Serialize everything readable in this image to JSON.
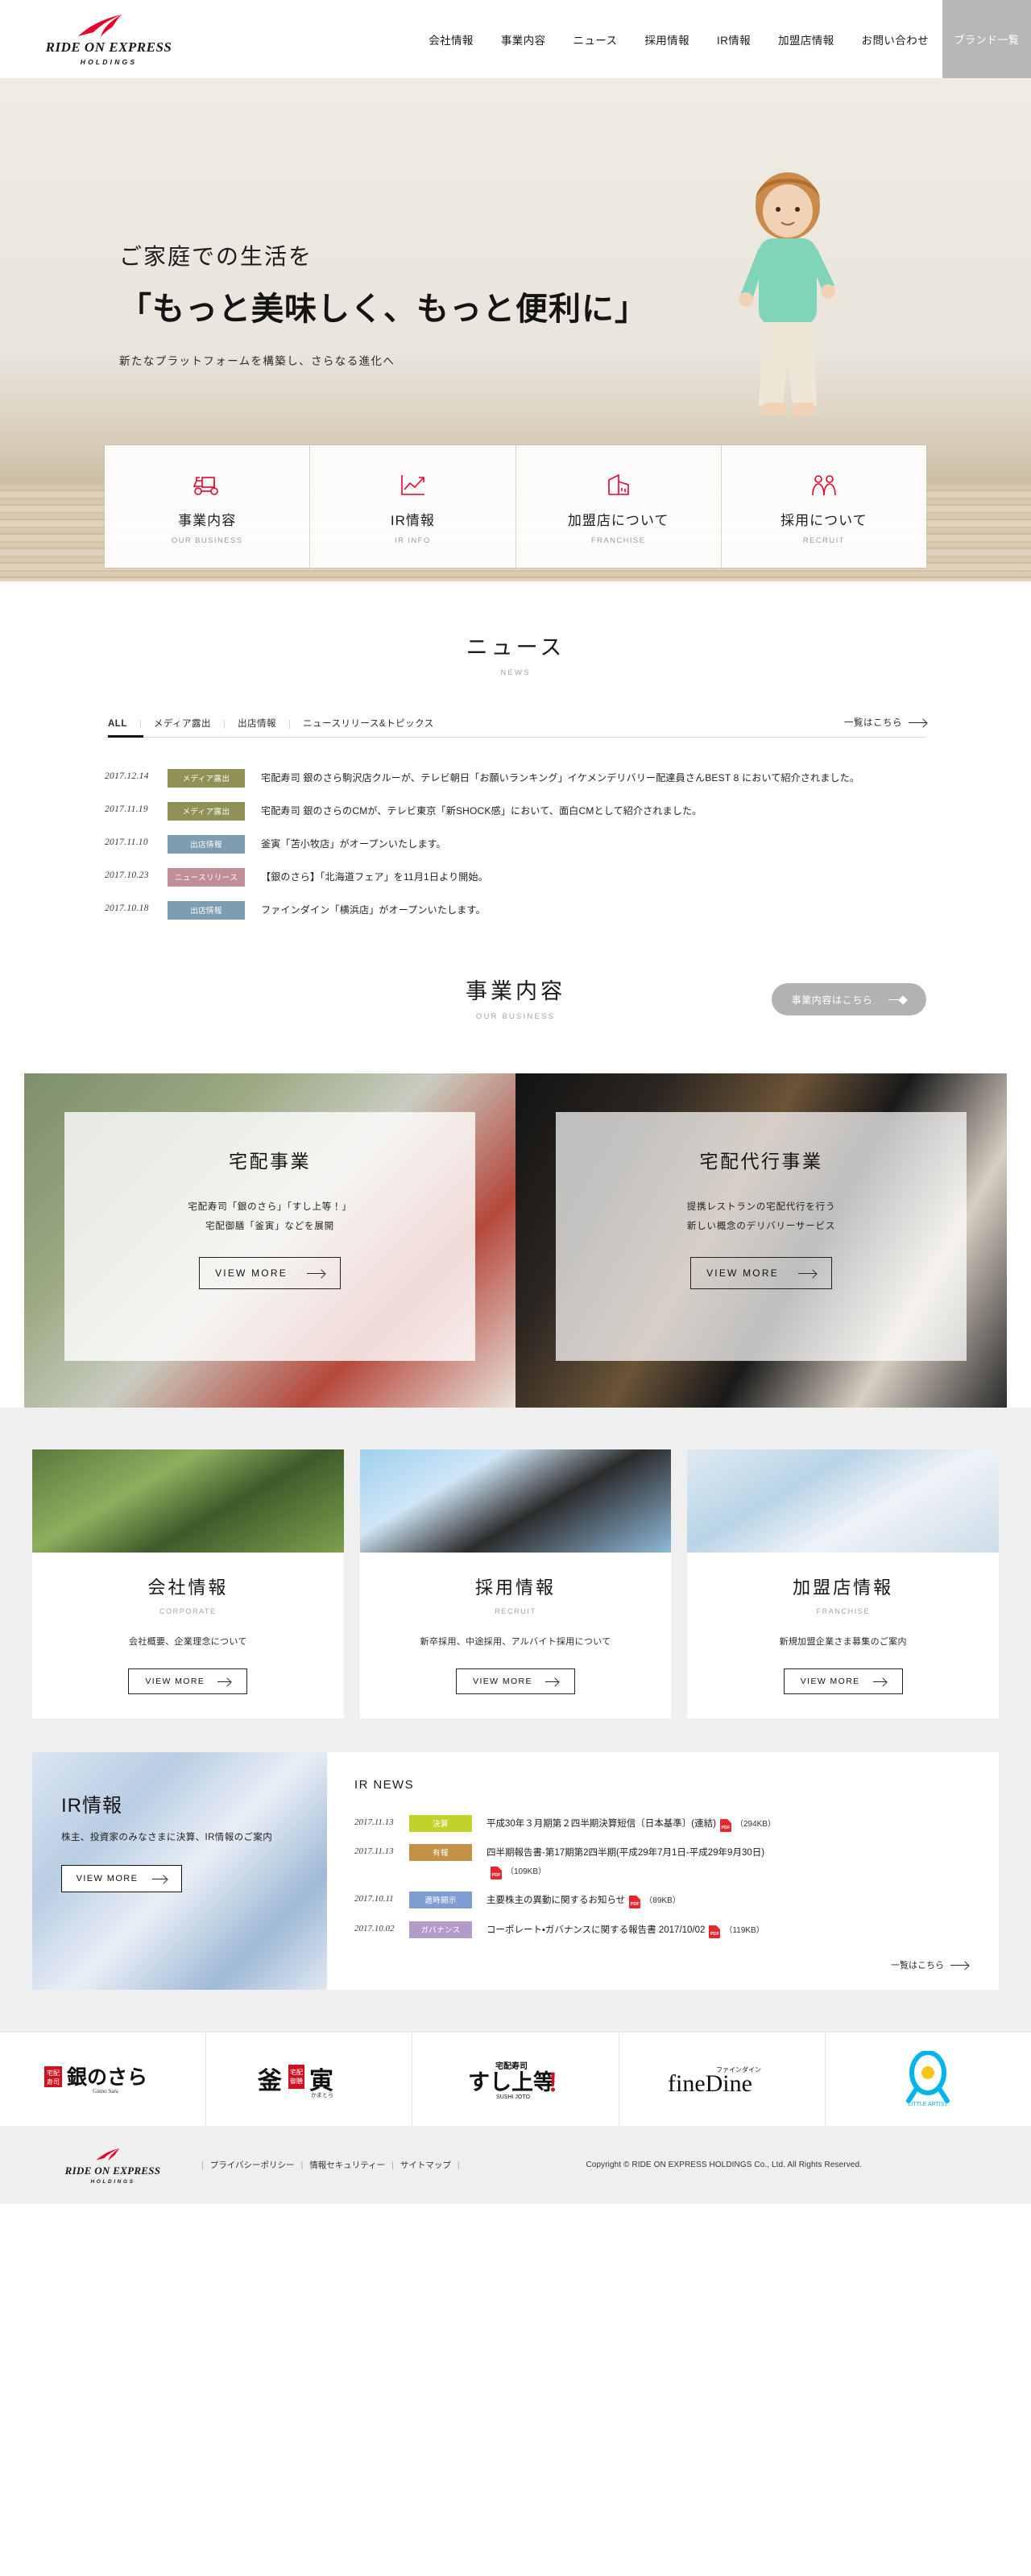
{
  "header": {
    "logo": {
      "name": "RIDE ON EXPRESS",
      "sub": "HOLDINGS",
      "mark": "red-arrow-logo"
    },
    "nav": [
      {
        "label": "会社情報"
      },
      {
        "label": "事業内容"
      },
      {
        "label": "ニュース"
      },
      {
        "label": "採用情報"
      },
      {
        "label": "IR情報"
      },
      {
        "label": "加盟店情報"
      },
      {
        "label": "お問い合わせ"
      }
    ],
    "brand_button": "ブランド一覧"
  },
  "hero": {
    "line1": "ご家庭での生活を",
    "line2": "「もっと美味しく、もっと便利に」",
    "sub": "新たなプラットフォームを構築し、さらなる進化へ"
  },
  "feature_cards": [
    {
      "jp": "事業内容",
      "en": "OUR BUSINESS",
      "icon": "delivery-scooter-icon"
    },
    {
      "jp": "IR情報",
      "en": "IR INFO",
      "icon": "line-chart-icon"
    },
    {
      "jp": "加盟店について",
      "en": "FRANCHISE",
      "icon": "building-icon"
    },
    {
      "jp": "採用について",
      "en": "RECRUIT",
      "icon": "people-icon"
    }
  ],
  "news": {
    "title_jp": "ニュース",
    "title_en": "NEWS",
    "tabs": [
      {
        "label": "ALL",
        "active": true
      },
      {
        "label": "メディア露出",
        "active": false
      },
      {
        "label": "出店情報",
        "active": false
      },
      {
        "label": "ニュースリリース&トピックス",
        "active": false
      }
    ],
    "all_link": "一覧はこちら",
    "items": [
      {
        "date": "2017.12.14",
        "cat": "メディア露出",
        "cat_color": "#8f9157",
        "text": "宅配寿司 銀のさら駒沢店クルーが、テレビ朝日「お願いランキング」イケメンデリバリー配達員さんBEST 8 において紹介されました。"
      },
      {
        "date": "2017.11.19",
        "cat": "メディア露出",
        "cat_color": "#8f9157",
        "text": "宅配寿司 銀のさらのCMが、テレビ東京「新SHOCK感」において、面白CMとして紹介されました。"
      },
      {
        "date": "2017.11.10",
        "cat": "出店情報",
        "cat_color": "#7e9db3",
        "text": "釜寅「苫小牧店」がオープンいたします。"
      },
      {
        "date": "2017.10.23",
        "cat": "ニュースリリース",
        "cat_color": "#c08e96",
        "text": "【銀のさら】「北海道フェア」を11月1日より開始。"
      },
      {
        "date": "2017.10.18",
        "cat": "出店情報",
        "cat_color": "#7e9db3",
        "text": "ファインダイン「横浜店」がオープンいたします。"
      }
    ]
  },
  "business": {
    "title_jp": "事業内容",
    "title_en": "OUR BUSINESS",
    "button": "事業内容はこちら",
    "cards": [
      {
        "title": "宅配事業",
        "desc_line1": "宅配寿司「銀のさら」「すし上等！」",
        "desc_line2": "宅配御膳「釜寅」などを展開",
        "button": "VIEW MORE"
      },
      {
        "title": "宅配代行事業",
        "desc_line1": "提携レストランの宅配代行を行う",
        "desc_line2": "新しい概念のデリバリーサービス",
        "button": "VIEW MORE"
      }
    ]
  },
  "trio": [
    {
      "jp": "会社情報",
      "en": "CORPORATE",
      "desc": "会社概要、企業理念について",
      "button": "VIEW MORE"
    },
    {
      "jp": "採用情報",
      "en": "RECRUIT",
      "desc": "新卒採用、中途採用、アルバイト採用について",
      "button": "VIEW MORE"
    },
    {
      "jp": "加盟店情報",
      "en": "FRANCHISE",
      "desc": "新規加盟企業さま募集のご案内",
      "button": "VIEW MORE"
    }
  ],
  "ir": {
    "title": "IR情報",
    "desc": "株主、投資家のみなさまに決算、IR情報のご案内",
    "button": "VIEW MORE",
    "news_title": "IR NEWS",
    "all_link": "一覧はこちら",
    "items": [
      {
        "date": "2017.11.13",
        "cat": "決算",
        "cat_color": "#c3d22a",
        "text": "平成30年３月期第２四半期決算短信〔日本基準〕(連結)",
        "size": "（294KB）"
      },
      {
        "date": "2017.11.13",
        "cat": "有報",
        "cat_color": "#c29246",
        "text": "四半期報告書-第17期第2四半期(平成29年7月1日-平成29年9月30日)",
        "size": "（109KB）"
      },
      {
        "date": "2017.10.11",
        "cat": "適時開示",
        "cat_color": "#7e9ed1",
        "text": "主要株主の異動に関するお知らせ",
        "size": "（89KB）"
      },
      {
        "date": "2017.10.02",
        "cat": "ガバナンス",
        "cat_color": "#b39bc9",
        "text": "コーポレート・ガバナンスに関する報告書 2017/10/02",
        "size": "（119KB）"
      }
    ]
  },
  "brands": [
    {
      "name": "銀のさら",
      "sub": "Ginno Sara",
      "tag": "宅配寿司"
    },
    {
      "name": "釜寅",
      "sub": "かまとら",
      "tag": "宅配御膳"
    },
    {
      "name": "すし上等！",
      "sub": "SUSHI JOTO",
      "tag": "宅配寿司"
    },
    {
      "name": "fineDine",
      "sub": "ファインダイン",
      "tag": ""
    },
    {
      "name": "LITTLE ARTIST",
      "sub": "",
      "tag": ""
    }
  ],
  "footer": {
    "logo": {
      "name": "RIDE ON EXPRESS",
      "sub": "HOLDINGS"
    },
    "links": [
      "プライバシーポリシー",
      "情報セキュリティー",
      "サイトマップ"
    ],
    "copyright": "Copyright © RIDE ON EXPRESS HOLDINGS Co., Ltd.  All Rights Reserved."
  }
}
